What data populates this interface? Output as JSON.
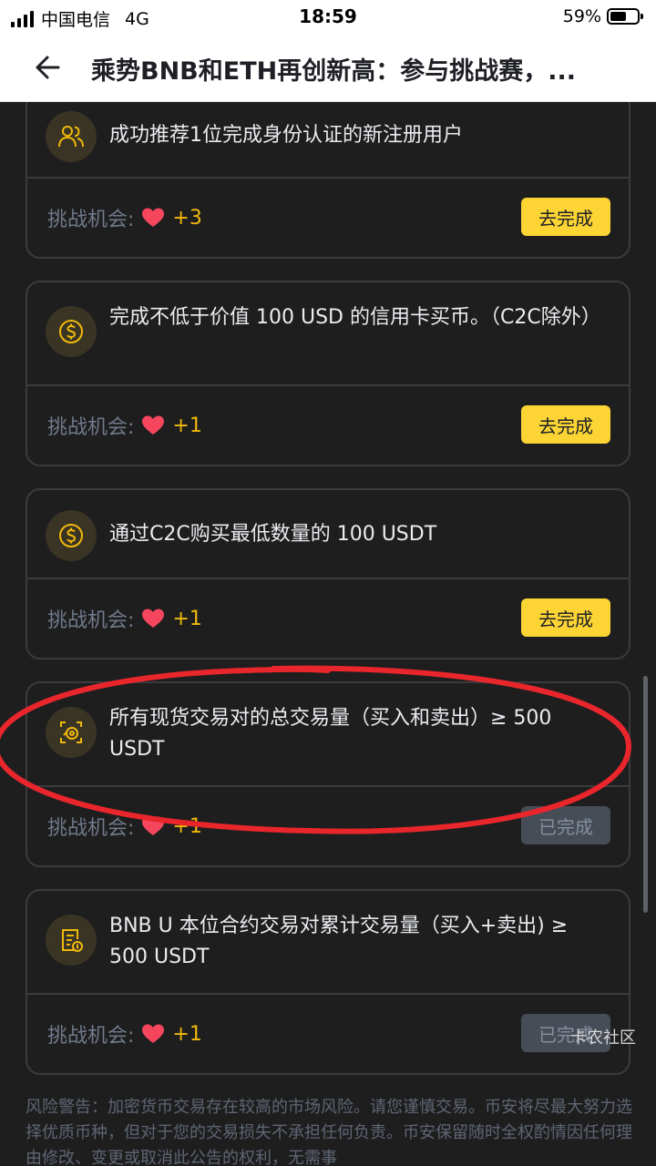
{
  "status_bar": {
    "carrier": "中国电信",
    "network": "4G",
    "time": "18:59",
    "battery": "59%",
    "battery_level": 0.59
  },
  "nav": {
    "title": "乘势BNB和ETH再创新高：参与挑战赛，..."
  },
  "tasks": [
    {
      "text": "成功推荐1位完成身份认证的新注册用户",
      "chance_label": "挑战机会:",
      "chance_value": "+3",
      "button_label": "去完成",
      "button_state": "go",
      "icon": "users-icon"
    },
    {
      "text": "完成不低于价值 100 USD 的信用卡买币。（C2C除外）",
      "chance_label": "挑战机会:",
      "chance_value": "+1",
      "button_label": "去完成",
      "button_state": "go",
      "icon": "dollar-coin-icon"
    },
    {
      "text": "通过C2C购买最低数量的 100 USDT",
      "chance_label": "挑战机会:",
      "chance_value": "+1",
      "button_label": "去完成",
      "button_state": "go",
      "icon": "dollar-coin-icon"
    },
    {
      "text": "所有现货交易对的总交易量（买入和卖出）≥ 500 USDT",
      "chance_label": "挑战机会:",
      "chance_value": "+1",
      "button_label": "已完成",
      "button_state": "done",
      "icon": "spot-trade-icon"
    },
    {
      "text": "BNB U 本位合约交易对累计交易量（买入+卖出) ≥ 500 USDT",
      "chance_label": "挑战机会:",
      "chance_value": "+1",
      "button_label": "已完成",
      "button_state": "done",
      "icon": "futures-document-icon"
    }
  ],
  "risk_warning": "风险警告：加密货币交易存在较高的市场风险。请您谨慎交易。币安将尽最大努力选择优质币种，但对于您的交易损失不承担任何负责。币安保留随时全权酌情因任何理由修改、变更或取消此公告的权利，无需事",
  "watermark": "卡农社区",
  "colors": {
    "accent": "#f0b90b",
    "button_yellow": "#fcd535",
    "heart": "#f6465d",
    "annotation_red": "#e8262b"
  }
}
